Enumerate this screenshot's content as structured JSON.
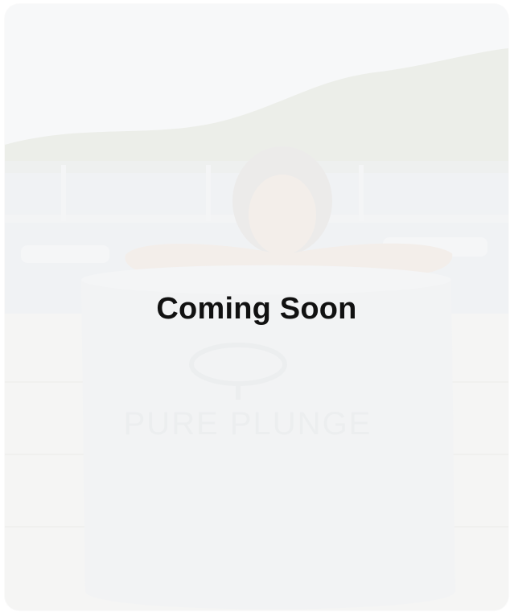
{
  "card": {
    "headline": "Coming Soon",
    "image_alt": "Woman resting arms on a round cold plunge tub on a dock by the water",
    "tub_logo_text": "PURE PLUNGE"
  },
  "colors": {
    "card_background": "#f6f7f8",
    "headline_text": "#111111",
    "tub_body": "#f1f2f3",
    "hills": "#e6e9e4",
    "water": "#eef1f3"
  }
}
